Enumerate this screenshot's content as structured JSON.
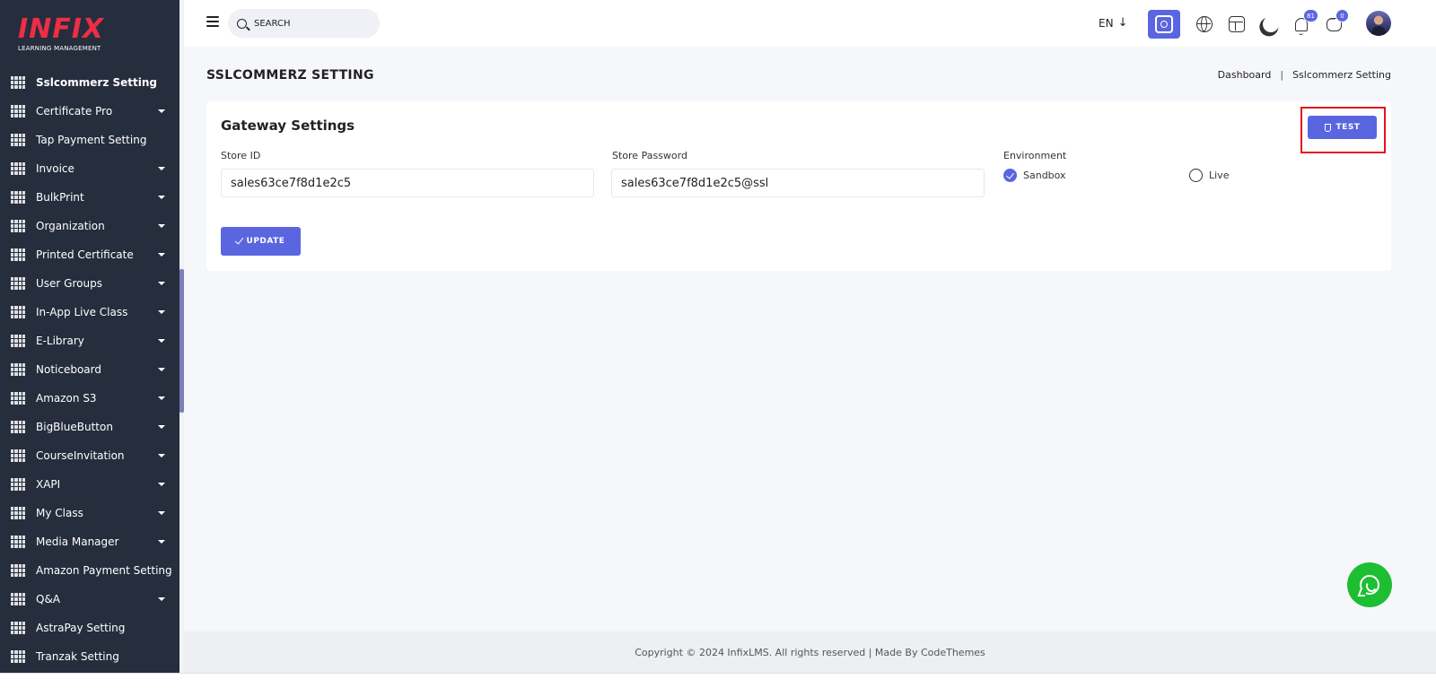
{
  "brand": {
    "name": "INFIX",
    "tagline": "LEARNING MANAGEMENT",
    "color": "#ee2d46"
  },
  "sidebar": {
    "items": [
      {
        "label": "Sslcommerz Setting",
        "has_caret": false,
        "active": true
      },
      {
        "label": "Certificate Pro",
        "has_caret": true
      },
      {
        "label": "Tap Payment Setting",
        "has_caret": false
      },
      {
        "label": "Invoice",
        "has_caret": true
      },
      {
        "label": "BulkPrint",
        "has_caret": true
      },
      {
        "label": "Organization",
        "has_caret": true
      },
      {
        "label": "Printed Certificate",
        "has_caret": true
      },
      {
        "label": "User Groups",
        "has_caret": true
      },
      {
        "label": "In-App Live Class",
        "has_caret": true
      },
      {
        "label": "E-Library",
        "has_caret": true
      },
      {
        "label": "Noticeboard",
        "has_caret": true
      },
      {
        "label": "Amazon S3",
        "has_caret": true
      },
      {
        "label": "BigBlueButton",
        "has_caret": true
      },
      {
        "label": "CourseInvitation",
        "has_caret": true
      },
      {
        "label": "XAPI",
        "has_caret": true
      },
      {
        "label": "My Class",
        "has_caret": true
      },
      {
        "label": "Media Manager",
        "has_caret": true
      },
      {
        "label": "Amazon Payment Setting",
        "has_caret": false
      },
      {
        "label": "Q&A",
        "has_caret": true
      },
      {
        "label": "AstraPay Setting",
        "has_caret": false
      },
      {
        "label": "Tranzak Setting",
        "has_caret": false
      }
    ]
  },
  "header": {
    "search_placeholder": "SEARCH",
    "language": "EN",
    "language_arrow": "↓",
    "notifications_count": "81",
    "messages_count": "0",
    "icons": [
      "menu-icon",
      "search-icon",
      "chip-icon",
      "globe-icon",
      "layout-icon",
      "moon-icon",
      "bell-icon",
      "chat-icon"
    ]
  },
  "page": {
    "title": "SSLCOMMERZ SETTING",
    "breadcrumb": [
      "Dashboard",
      "Sslcommerz Setting"
    ],
    "breadcrumb_separator": "|"
  },
  "gateway": {
    "title": "Gateway Settings",
    "test_label": "TEST",
    "store_id_label": "Store ID",
    "store_id_value": "sales63ce7f8d1e2c5",
    "store_password_label": "Store Password",
    "store_password_value": "sales63ce7f8d1e2c5@ssl",
    "environment_label": "Environment",
    "environment_options": [
      "Sandbox",
      "Live"
    ],
    "environment_selected": "Sandbox",
    "update_label": "UPDATE"
  },
  "footer": {
    "text": "Copyright © 2024 InfixLMS. All rights reserved | Made By CodeThemes"
  },
  "colors": {
    "primary": "#5a66e0",
    "sidebar_bg": "#262d3d",
    "highlight": "#e6121b",
    "whatsapp": "#1ebe33"
  }
}
